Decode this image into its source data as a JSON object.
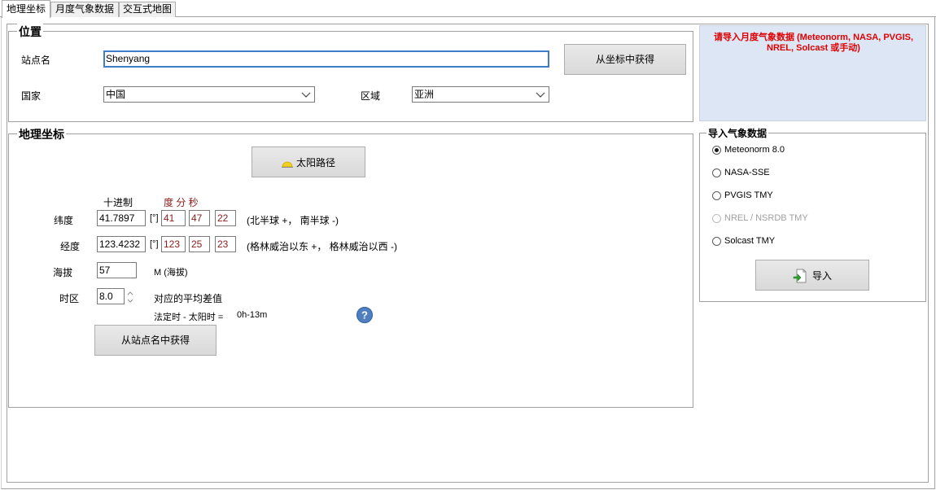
{
  "tabs": [
    "地理坐标",
    "月度气象数据",
    "交互式地图"
  ],
  "location": {
    "group_title": "位置",
    "site_name_label": "站点名",
    "site_name_value": "Shenyang",
    "get_from_coords_button": "从坐标中获得",
    "country_label": "国家",
    "country_value": "中国",
    "region_label": "区域",
    "region_value": "亚洲"
  },
  "coordinates": {
    "group_title": "地理坐标",
    "sun_path_button": "太阳路径",
    "decimal_header": "十进制",
    "dms_header": "度 分 秒",
    "latitude": {
      "label": "纬度",
      "decimal": "41.7897",
      "unit": "[°]",
      "deg": "41",
      "min": "47",
      "sec": "22",
      "hint": "(北半球 +， 南半球 -)"
    },
    "longitude": {
      "label": "经度",
      "decimal": "123.4232",
      "unit": "[°]",
      "deg": "123",
      "min": "25",
      "sec": "23",
      "hint": "(格林威治以东 +， 格林威治以西 -)"
    },
    "altitude": {
      "label": "海拔",
      "value": "57",
      "unit": "M (海拔)"
    },
    "timezone": {
      "label": "时区",
      "value": "8.0",
      "mean_diff_label": "对应的平均差值",
      "legal_solar_label": "法定时 - 太阳时 =",
      "legal_solar_value": "0h-13m"
    },
    "get_from_site_button": "从站点名中获得"
  },
  "info_message": "请导入月度气象数据 (Meteonorm, NASA, PVGIS, NREL, Solcast 或手动)",
  "import": {
    "group_title": "导入气象数据",
    "options": [
      {
        "label": "Meteonorm 8.0",
        "selected": true,
        "disabled": false
      },
      {
        "label": "NASA-SSE",
        "selected": false,
        "disabled": false
      },
      {
        "label": "PVGIS TMY",
        "selected": false,
        "disabled": false
      },
      {
        "label": "NREL / NSRDB TMY",
        "selected": false,
        "disabled": true
      },
      {
        "label": "Solcast TMY",
        "selected": false,
        "disabled": false
      }
    ],
    "import_button": "导入"
  },
  "colors": {
    "accent_focus": "#3d7cc9",
    "info_background": "#dce6f5",
    "info_text": "#e00000",
    "dms_text": "#8b1a1a"
  },
  "icons": {
    "sun": "sun-path-icon",
    "help": "help-icon",
    "import": "import-file-icon",
    "dropdown": "chevron-down-icon"
  }
}
